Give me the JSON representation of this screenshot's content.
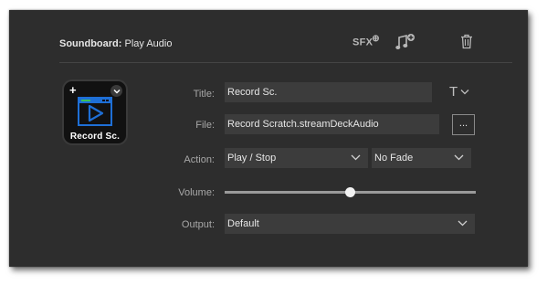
{
  "header": {
    "title_bold": "Soundboard:",
    "title_rest": " Play Audio",
    "sfx_label": "SFX",
    "sfx_plus": "⊕"
  },
  "key": {
    "title": "Record Sc.",
    "plus": "+"
  },
  "form": {
    "title_label": "Title:",
    "title_value": "Record Sc.",
    "title_style_glyph": "T",
    "file_label": "File:",
    "file_value": "Record Scratch.streamDeckAudio",
    "browse_label": "...",
    "action_label": "Action:",
    "action_value": "Play / Stop",
    "fade_value": "No Fade",
    "volume_label": "Volume:",
    "volume_level": 0.5,
    "output_label": "Output:",
    "output_value": "Default"
  },
  "colors": {
    "panel_bg": "#2d2d2d",
    "field_bg": "#3c3c3c",
    "key_icon_blue": "#1e6fd6",
    "key_icon_green": "#3ec35a"
  }
}
